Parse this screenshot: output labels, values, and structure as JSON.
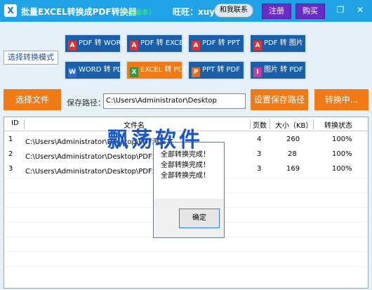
{
  "titlebar": {
    "title": "批量EXCEL转换成PDF转换器",
    "version": "（1.0版本）",
    "wangwang": "旺旺：xuyan3w",
    "contact_label": "和我联系",
    "register_label": "注册",
    "buy_label": "购买",
    "restore_glyph": "❐",
    "close_glyph": "✕"
  },
  "mode_label": "选择转换模式",
  "conversions": [
    {
      "label": "PDF 转 WORD",
      "icon": "pdf-icon",
      "active": false
    },
    {
      "label": "PDF 转 EXCEL",
      "icon": "pdf-icon",
      "active": false
    },
    {
      "label": "PDF 转 PPT",
      "icon": "pdf-icon",
      "active": false
    },
    {
      "label": "PDF 转 图片",
      "icon": "pdf-icon",
      "active": false
    },
    {
      "label": "WORD 转 PDF",
      "icon": "word-icon",
      "active": false
    },
    {
      "label": "EXCEL 转 PDF",
      "icon": "excel-icon",
      "active": true
    },
    {
      "label": "PPT 转 PDF",
      "icon": "ppt-icon",
      "active": false
    },
    {
      "label": "图片 转 PDF",
      "icon": "image-icon",
      "active": false
    }
  ],
  "icon_glyphs": {
    "pdf": "A",
    "word": "W",
    "excel": "X",
    "ppt": "P",
    "img": "I"
  },
  "toolbar": {
    "select_file_label": "选择文件",
    "save_path_label": "保存路径：",
    "save_path_value": "C:\\Users\\Administrator\\Desktop",
    "set_save_path_label": "设置保存路径",
    "converting_label": "转换中..."
  },
  "table": {
    "headers": {
      "id": "ID",
      "filename": "文件名",
      "pages": "页数",
      "size": "大小（KB）",
      "status": "转换状态"
    },
    "rows": [
      {
        "id": "1",
        "path": "C:\\Users\\Administrator\\Desktop\\PDF测试文",
        "pages": "4",
        "size": "260",
        "status": "100%"
      },
      {
        "id": "2",
        "path": "C:\\Users\\Administrator\\Desktop\\PDF测试文",
        "pages": "3",
        "size": "28",
        "status": "100%"
      },
      {
        "id": "3",
        "path": "C:\\Users\\Administrator\\Desktop\\PDF测试文",
        "pages": "3",
        "size": "169",
        "status": "100%"
      }
    ]
  },
  "dialog": {
    "messages": [
      "全部转换完成！",
      "全部转换完成！",
      "全部转换完成！"
    ],
    "ok_label": "确定"
  },
  "watermark": "飘荡软件",
  "colors": {
    "titlebar": "#1fa3e6",
    "button_blue": "#1b5fa8",
    "button_orange": "#f07a16",
    "register_purple": "#6a2bc7",
    "version_green": "#33ff66"
  }
}
